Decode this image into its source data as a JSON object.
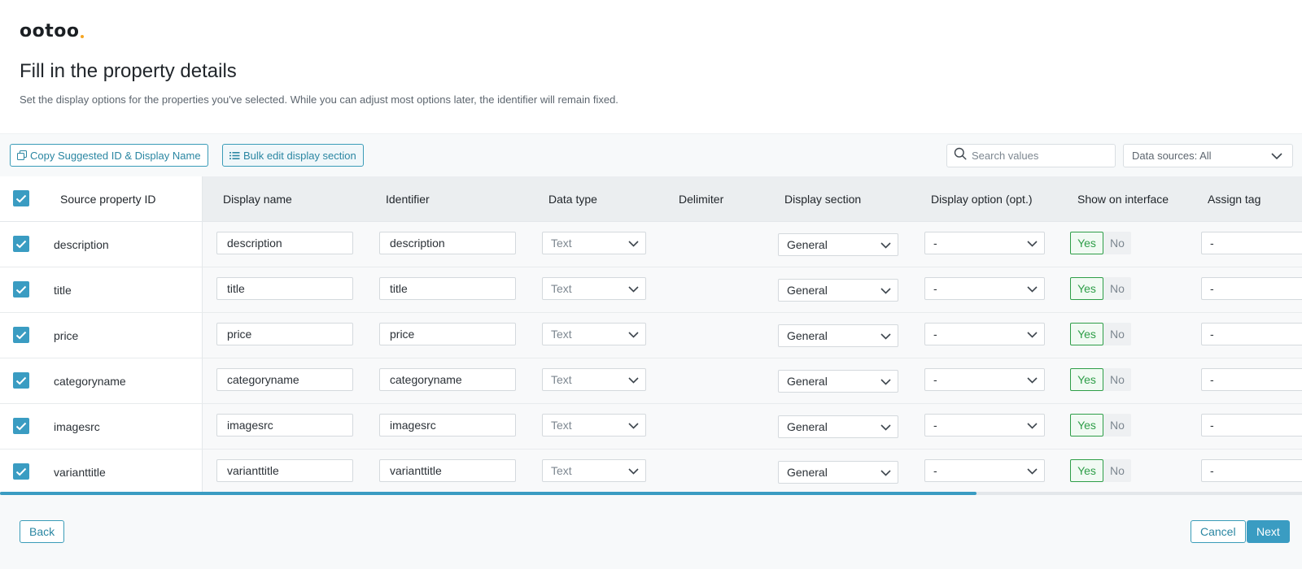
{
  "brand": {
    "logo_text": "ootoo",
    "accent_color": "#f5a623"
  },
  "header": {
    "title": "Fill in the property details",
    "subtitle": "Set the display options for the properties you've selected. While you can adjust most options later, the identifier will remain fixed."
  },
  "toolbar": {
    "copy_label": "Copy Suggested ID & Display Name",
    "bulk_label": "Bulk edit display section",
    "search_placeholder": "Search values",
    "data_sources_label": "Data sources: All"
  },
  "table": {
    "columns": {
      "source_id": "Source property ID",
      "display_name": "Display name",
      "identifier": "Identifier",
      "data_type": "Data type",
      "delimiter": "Delimiter",
      "display_section": "Display section",
      "display_option": "Display option (opt.)",
      "show_on_interface": "Show on interface",
      "assign_tag": "Assign tag"
    },
    "rows": [
      {
        "source_id": "description",
        "display_name": "description",
        "identifier": "description",
        "data_type": "Text",
        "display_section": "General",
        "display_option": "-",
        "yes": "Yes",
        "no": "No",
        "tag": "-"
      },
      {
        "source_id": "title",
        "display_name": "title",
        "identifier": "title",
        "data_type": "Text",
        "display_section": "General",
        "display_option": "-",
        "yes": "Yes",
        "no": "No",
        "tag": "-"
      },
      {
        "source_id": "price",
        "display_name": "price",
        "identifier": "price",
        "data_type": "Text",
        "display_section": "General",
        "display_option": "-",
        "yes": "Yes",
        "no": "No",
        "tag": "-"
      },
      {
        "source_id": "categoryname",
        "display_name": "categoryname",
        "identifier": "categoryname",
        "data_type": "Text",
        "display_section": "General",
        "display_option": "-",
        "yes": "Yes",
        "no": "No",
        "tag": "-"
      },
      {
        "source_id": "imagesrc",
        "display_name": "imagesrc",
        "identifier": "imagesrc",
        "data_type": "Text",
        "display_section": "General",
        "display_option": "-",
        "yes": "Yes",
        "no": "No",
        "tag": "-"
      },
      {
        "source_id": "varianttitle",
        "display_name": "varianttitle",
        "identifier": "varianttitle",
        "data_type": "Text",
        "display_section": "General",
        "display_option": "-",
        "yes": "Yes",
        "no": "No",
        "tag": "-"
      }
    ]
  },
  "footer": {
    "back_label": "Back",
    "cancel_label": "Cancel",
    "next_label": "Next"
  },
  "colors": {
    "primary": "#3a9cc2",
    "success": "#2e9e48"
  }
}
